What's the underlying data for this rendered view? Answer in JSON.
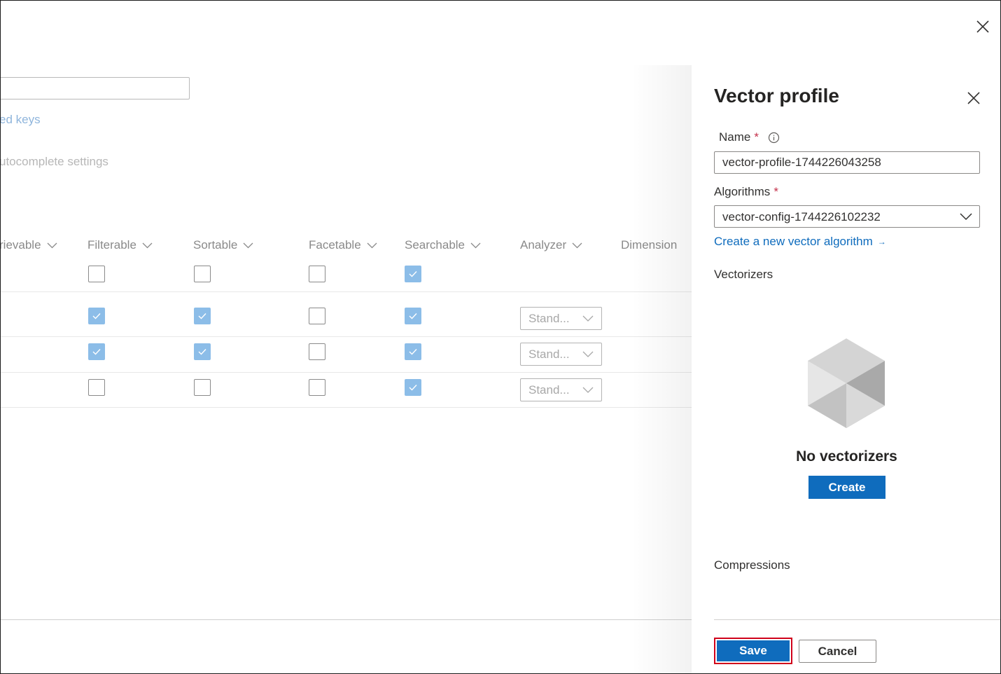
{
  "background": {
    "link_text": "ed keys",
    "muted_text": "utocomplete settings",
    "columns": [
      "rievable",
      "Filterable",
      "Sortable",
      "Facetable",
      "Searchable",
      "Analyzer",
      "Dimension"
    ],
    "rows": [
      {
        "filterable": false,
        "sortable": false,
        "facetable": false,
        "searchable": true,
        "analyzer": ""
      },
      {
        "filterable": true,
        "sortable": true,
        "facetable": false,
        "searchable": true,
        "analyzer": "Stand..."
      },
      {
        "filterable": true,
        "sortable": true,
        "facetable": false,
        "searchable": true,
        "analyzer": "Stand..."
      },
      {
        "filterable": false,
        "sortable": false,
        "facetable": false,
        "searchable": true,
        "analyzer": "Stand..."
      }
    ]
  },
  "panel": {
    "title": "Vector profile",
    "name_label": "Name",
    "required_mark": "*",
    "name_value": "vector-profile-1744226043258",
    "algorithms_label": "Algorithms",
    "algorithm_value": "vector-config-1744226102232",
    "create_algorithm_link": "Create a new vector algorithm",
    "link_arrow": "→",
    "vectorizers_label": "Vectorizers",
    "empty_title": "No vectorizers",
    "create_button": "Create",
    "compressions_label": "Compressions",
    "save_button": "Save",
    "cancel_button": "Cancel"
  },
  "colors": {
    "primary": "#0f6cbd",
    "required": "#c4314b",
    "highlight_border": "#d0021b",
    "checkbox_checked": "#8cbde8"
  },
  "icons": {
    "outer_close": "close-icon",
    "panel_close": "close-icon",
    "info": "info-icon",
    "dropdown": "chevron-down-icon",
    "empty_state": "cube-icon"
  }
}
